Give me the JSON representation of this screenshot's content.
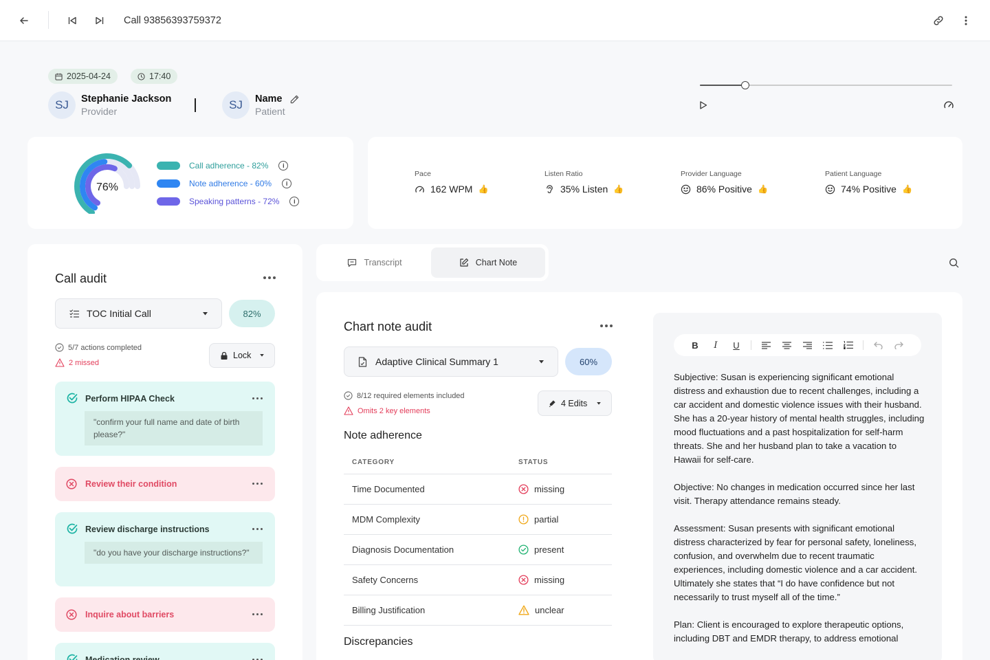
{
  "header": {
    "title": "Call 93856393759372"
  },
  "meta": {
    "date": "2025-04-24",
    "time": "17:40"
  },
  "participants": {
    "provider": {
      "initials": "SJ",
      "name": "Stephanie Jackson",
      "role": "Provider"
    },
    "patient": {
      "initials": "SJ",
      "name": "Name",
      "role": "Patient"
    }
  },
  "player": {
    "progress": 0.18
  },
  "score": {
    "overall": "76%",
    "rings": [
      {
        "label": "Call adherence - 82%",
        "value": 0.82,
        "color": "#3bb3b0",
        "label_color": "#2e9e9b"
      },
      {
        "label": "Note adherence - 60%",
        "value": 0.6,
        "color": "#2f86f2",
        "label_color": "#2f7ae5"
      },
      {
        "label": "Speaking patterns - 72%",
        "value": 0.72,
        "color": "#6e66e8",
        "label_color": "#5a52d8"
      }
    ]
  },
  "metrics": [
    {
      "label": "Pace",
      "value": "162 WPM",
      "icon": "gauge-icon"
    },
    {
      "label": "Listen Ratio",
      "value": "35% Listen",
      "icon": "ear-icon"
    },
    {
      "label": "Provider Language",
      "value": "86% Positive",
      "icon": "smile-icon"
    },
    {
      "label": "Patient Language",
      "value": "74% Positive",
      "icon": "smile-icon"
    }
  ],
  "call_audit": {
    "title": "Call audit",
    "template": "TOC Initial Call",
    "score": "82%",
    "completed": "5/7 actions completed",
    "missed": "2 missed",
    "lock_label": "Lock",
    "actions": [
      {
        "status": "ok",
        "title": "Perform HIPAA Check",
        "quote": "\"confirm your full name and date of birth please?\""
      },
      {
        "status": "bad",
        "title": "Review their condition"
      },
      {
        "status": "ok",
        "title": "Review discharge instructions",
        "quote": "\"do you have your discharge instructions?\""
      },
      {
        "status": "bad",
        "title": "Inquire about barriers"
      },
      {
        "status": "ok",
        "title": "Medication review"
      }
    ]
  },
  "tabs": [
    {
      "label": "Transcript",
      "active": false
    },
    {
      "label": "Chart Note",
      "active": true
    }
  ],
  "chart_audit": {
    "title": "Chart note audit",
    "template": "Adaptive Clinical Summary 1",
    "score": "60%",
    "included": "8/12 required elements included",
    "omits": "Omits 2 key elements",
    "edits_label": "4 Edits",
    "adherence_title": "Note adherence",
    "columns": [
      "CATEGORY",
      "STATUS"
    ],
    "rows": [
      {
        "category": "Time Documented",
        "status": "missing",
        "kind": "x"
      },
      {
        "category": "MDM Complexity",
        "status": "partial",
        "kind": "warn"
      },
      {
        "category": "Diagnosis Documentation",
        "status": "present",
        "kind": "ok"
      },
      {
        "category": "Safety Concerns",
        "status": "missing",
        "kind": "x"
      },
      {
        "category": "Billing Justification",
        "status": "unclear",
        "kind": "tri"
      }
    ],
    "discrepancies_title": "Discrepancies"
  },
  "note": {
    "paragraphs": [
      "Subjective: Susan is experiencing significant emotional distress and exhaustion due to recent challenges, including a car accident and domestic violence issues with their husband. She has a 20-year history of mental health struggles, including mood fluctuations and a past hospitalization for self-harm threats. She and her husband plan to take a vacation to Hawaii for self-care.",
      "Objective: No changes in medication occurred since her last visit. Therapy attendance remains steady.",
      "Assessment: Susan presents with significant emotional distress characterized by fear for personal safety, loneliness, confusion, and overwhelm due to recent traumatic experiences, including domestic violence and a car accident. Ultimately she states that “I do have confidence but not necessarily to trust myself all of the time.”",
      "Plan: Client is encouraged to explore therapeutic options, including DBT and EMDR therapy, to address emotional"
    ]
  }
}
